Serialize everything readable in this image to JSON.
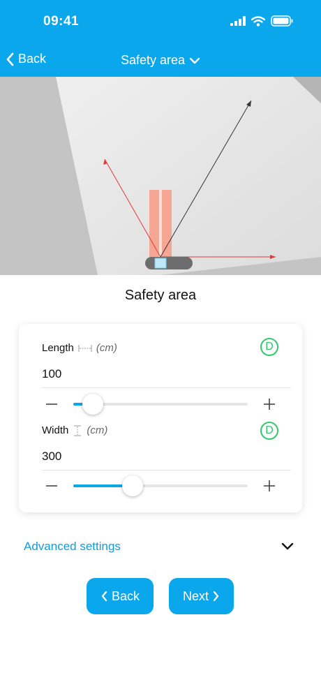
{
  "status_bar": {
    "time": "09:41",
    "icons": [
      "signal-icon",
      "wifi-icon",
      "battery-icon"
    ]
  },
  "nav": {
    "back_label": "Back",
    "title": "Safety area"
  },
  "section_title": "Safety area",
  "params": {
    "length": {
      "label": "Length",
      "unit": "(cm)",
      "value": "100",
      "badge": "D",
      "slider_fraction": 0.11
    },
    "width": {
      "label": "Width",
      "unit": "(cm)",
      "value": "300",
      "badge": "D",
      "slider_fraction": 0.34
    }
  },
  "advanced_label": "Advanced settings",
  "buttons": {
    "back": "Back",
    "next": "Next"
  },
  "colors": {
    "accent": "#0aa7ec",
    "badge_green": "#2fc96a",
    "safety_zone": "#f7a08a"
  }
}
